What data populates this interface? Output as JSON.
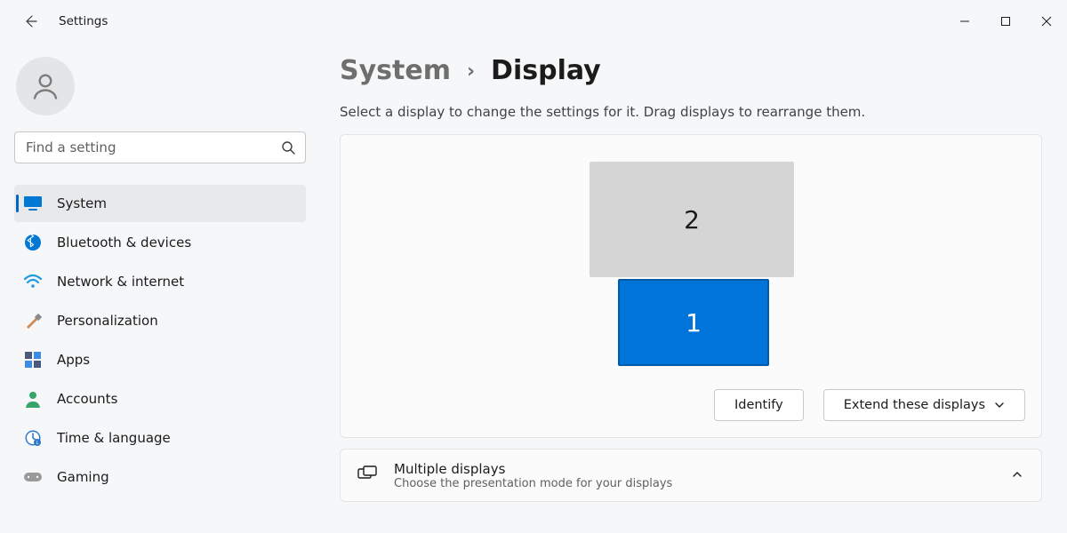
{
  "window_title": "Settings",
  "search": {
    "placeholder": "Find a setting"
  },
  "sidebar": {
    "items": [
      {
        "label": "System",
        "icon": "monitor",
        "selected": true
      },
      {
        "label": "Bluetooth & devices",
        "icon": "bluetooth",
        "selected": false
      },
      {
        "label": "Network & internet",
        "icon": "wifi",
        "selected": false
      },
      {
        "label": "Personalization",
        "icon": "brush",
        "selected": false
      },
      {
        "label": "Apps",
        "icon": "apps",
        "selected": false
      },
      {
        "label": "Accounts",
        "icon": "account",
        "selected": false
      },
      {
        "label": "Time & language",
        "icon": "clock",
        "selected": false
      },
      {
        "label": "Gaming",
        "icon": "gamepad",
        "selected": false
      }
    ]
  },
  "breadcrumb": {
    "parent": "System",
    "current": "Display"
  },
  "instruction": "Select a display to change the settings for it. Drag displays to rearrange them.",
  "displays": [
    {
      "id": "2",
      "selected": false
    },
    {
      "id": "1",
      "selected": true
    }
  ],
  "buttons": {
    "identify": "Identify",
    "mode_label": "Extend these displays"
  },
  "multiple_displays": {
    "title": "Multiple displays",
    "subtitle": "Choose the presentation mode for your displays"
  }
}
